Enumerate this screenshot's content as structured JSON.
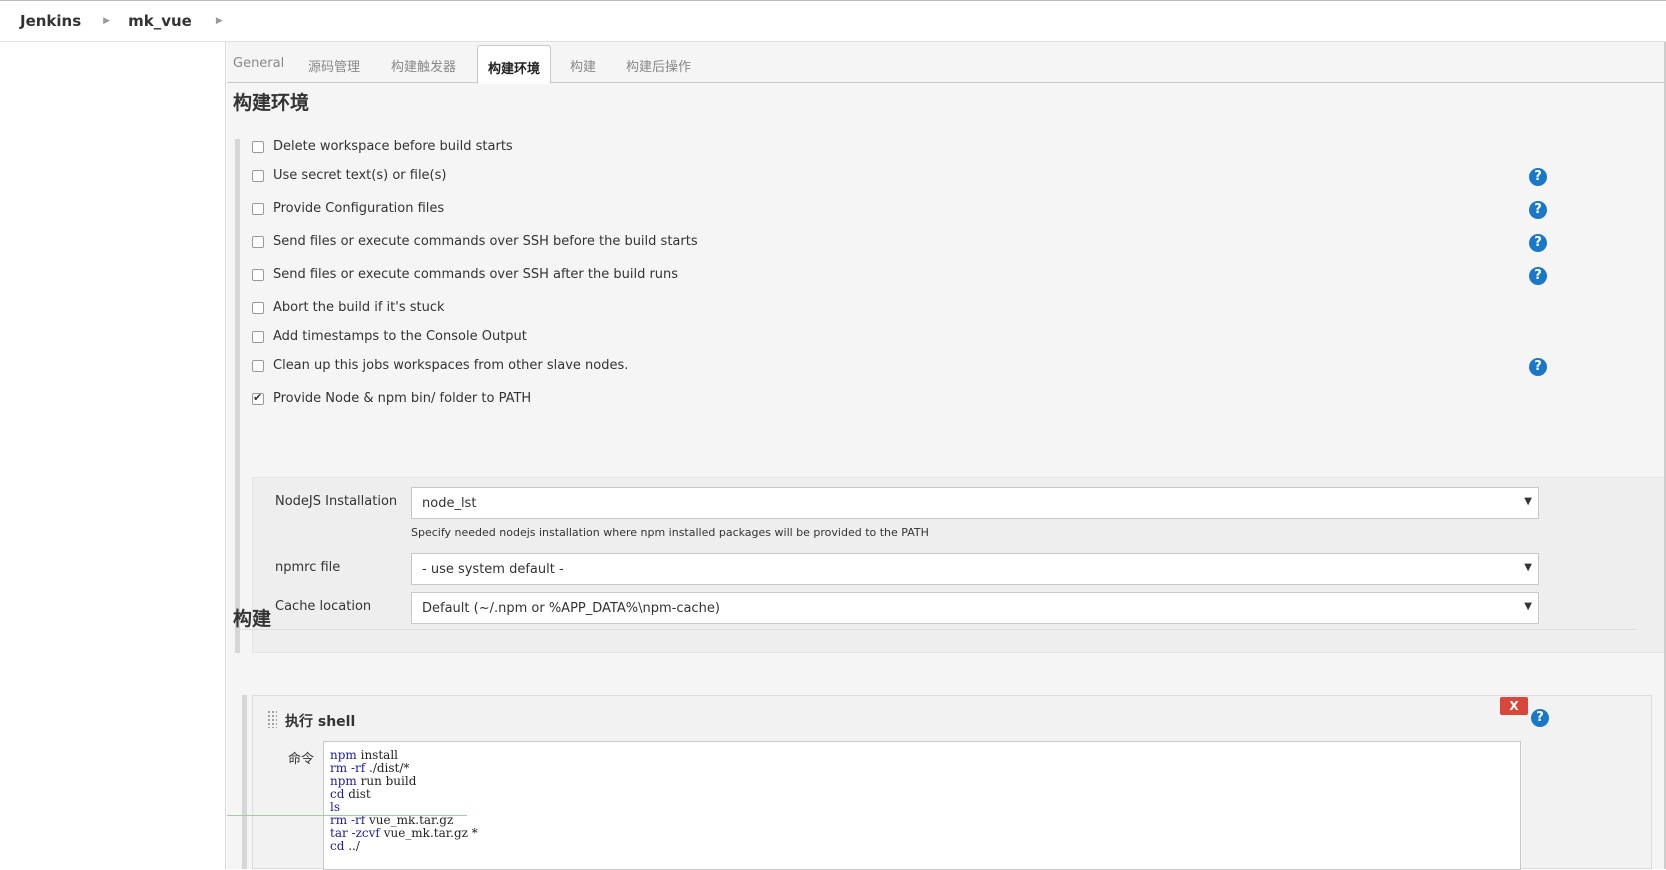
{
  "breadcrumb": {
    "root": "Jenkins",
    "job": "mk_vue"
  },
  "tabs": [
    "General",
    "源码管理",
    "构建触发器",
    "构建环境",
    "构建",
    "构建后操作"
  ],
  "active_tab": "构建环境",
  "build_env": {
    "title": "构建环境",
    "options": [
      {
        "label": "Delete workspace before build starts",
        "checked": false,
        "help": false
      },
      {
        "label": "Use secret text(s) or file(s)",
        "checked": false,
        "help": true
      },
      {
        "label": "Provide Configuration files",
        "checked": false,
        "help": true
      },
      {
        "label": "Send files or execute commands over SSH before the build starts",
        "checked": false,
        "help": true
      },
      {
        "label": "Send files or execute commands over SSH after the build runs",
        "checked": false,
        "help": true
      },
      {
        "label": "Abort the build if it's stuck",
        "checked": false,
        "help": false
      },
      {
        "label": "Add timestamps to the Console Output",
        "checked": false,
        "help": false
      },
      {
        "label": "Clean up this jobs workspaces from other slave nodes.",
        "checked": false,
        "help": true
      },
      {
        "label": "Provide Node & npm bin/ folder to PATH",
        "checked": true,
        "help": false
      }
    ],
    "node": {
      "installation_label": "NodeJS Installation",
      "installation_value": "node_lst",
      "installation_hint": "Specify needed nodejs installation where npm installed packages will be provided to the PATH",
      "npmrc_label": "npmrc file",
      "npmrc_value": "- use system default -",
      "cache_label": "Cache location",
      "cache_value": "Default (~/.npm or %APP_DATA%\\npm-cache)"
    }
  },
  "build": {
    "title": "构建",
    "step_title": "执行 shell",
    "delete_label": "X",
    "command_label": "命令",
    "command_lines": [
      [
        "npm",
        " install"
      ],
      [
        "rm",
        " ",
        "-rf",
        " ./dist/*"
      ],
      [
        "npm",
        " run build"
      ],
      [
        "cd",
        " dist"
      ],
      [
        "ls",
        ""
      ],
      [
        "rm",
        " ",
        "-rf",
        " vue_mk.tar.gz"
      ],
      [
        "tar",
        " ",
        "-zcvf",
        " vue_mk.tar.gz *"
      ],
      [
        "cd",
        " ../"
      ]
    ]
  },
  "icons": {
    "help": "help-icon",
    "separator": "chevron-right-icon",
    "dropdown": "caret-down-icon",
    "drag": "drag-handle-icon"
  },
  "colors": {
    "help": "#1b78c8",
    "delete": "#d9463a",
    "keyword": "#1a1aa6"
  }
}
